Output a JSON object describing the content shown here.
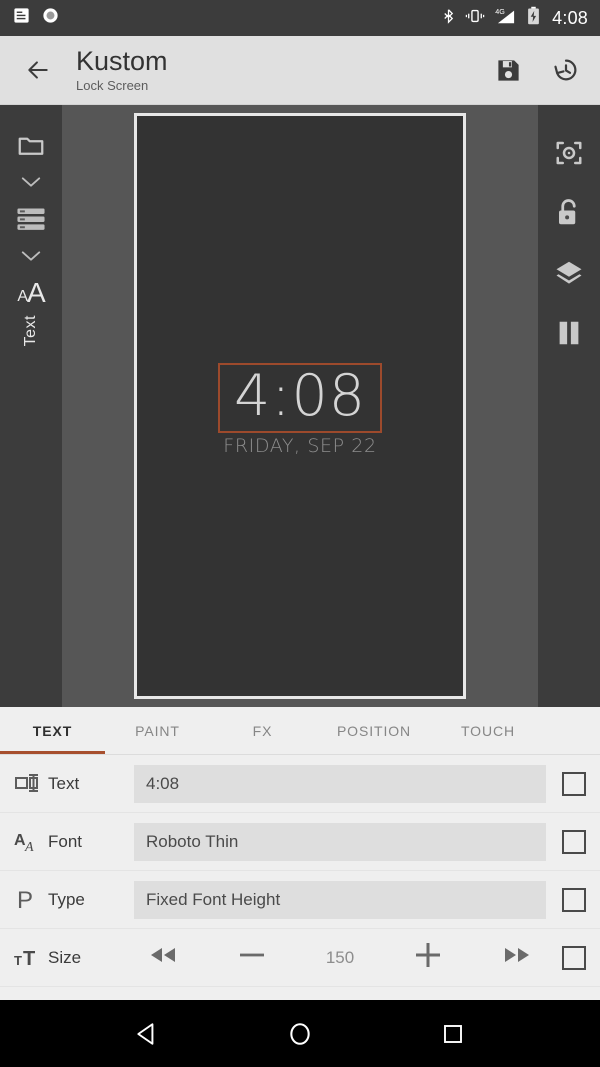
{
  "statusbar": {
    "time": "4:08",
    "left_icons": [
      "notification-list-icon",
      "record-circle-icon"
    ],
    "right_icons": [
      "bluetooth-icon",
      "vibrate-icon",
      "signal-4g-icon",
      "battery-charging-icon"
    ]
  },
  "appbar": {
    "back": "back-arrow",
    "title": "Kustom",
    "subtitle": "Lock Screen",
    "actions": [
      "save-icon",
      "history-icon"
    ]
  },
  "preview": {
    "left_rail": {
      "items": [
        "folder-icon",
        "chevron-down-icon",
        "layers-list-icon",
        "chevron-down-icon",
        "font-aa-icon"
      ],
      "label": "Text"
    },
    "right_rail": {
      "items": [
        "focus-frame-icon",
        "unlock-icon",
        "layers-icon",
        "pause-icon"
      ]
    },
    "widget": {
      "clock": "4:08",
      "date": "FRIDAY, SEP 22",
      "selection_color": "#9d4a2c"
    },
    "canvas_bg": "#333333",
    "stage_bg": "#565656"
  },
  "tabs": {
    "active_index": 0,
    "accent": "#a74f2e",
    "items": [
      {
        "label": "TEXT"
      },
      {
        "label": "PAINT"
      },
      {
        "label": "FX"
      },
      {
        "label": "POSITION"
      },
      {
        "label": "TOUCH"
      }
    ]
  },
  "settings": {
    "rows": [
      {
        "icon": "text-box-icon",
        "label": "Text",
        "value": "4:08",
        "type": "field",
        "checked": false
      },
      {
        "icon": "font-aa-icon",
        "label": "Font",
        "value": "Roboto Thin",
        "type": "field",
        "checked": false
      },
      {
        "icon": "paragraph-p-icon",
        "label": "Type",
        "value": "Fixed Font Height",
        "type": "field",
        "checked": false
      },
      {
        "icon": "size-tt-icon",
        "label": "Size",
        "value": "150",
        "type": "stepper",
        "checked": false,
        "controls": [
          "rewind-icon",
          "minus-icon",
          "plus-icon",
          "fastforward-icon"
        ]
      }
    ]
  },
  "navbar": {
    "items": [
      "back-triangle-icon",
      "home-circle-icon",
      "recents-square-icon"
    ]
  }
}
